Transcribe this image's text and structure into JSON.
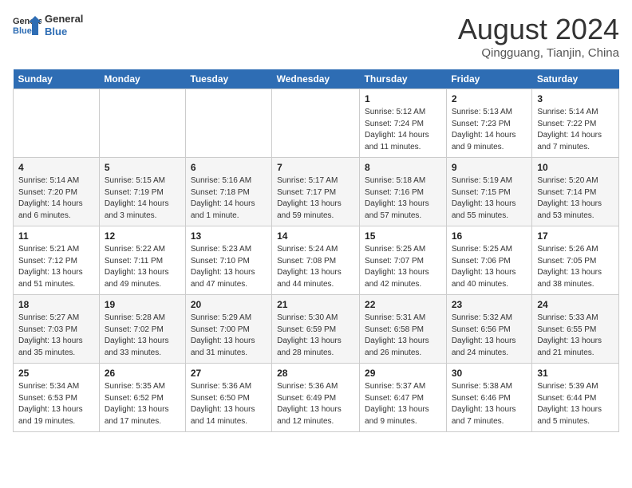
{
  "header": {
    "logo_line1": "General",
    "logo_line2": "Blue",
    "month_year": "August 2024",
    "location": "Qingguang, Tianjin, China"
  },
  "days_of_week": [
    "Sunday",
    "Monday",
    "Tuesday",
    "Wednesday",
    "Thursday",
    "Friday",
    "Saturday"
  ],
  "weeks": [
    [
      {
        "day": "",
        "info": ""
      },
      {
        "day": "",
        "info": ""
      },
      {
        "day": "",
        "info": ""
      },
      {
        "day": "",
        "info": ""
      },
      {
        "day": "1",
        "info": "Sunrise: 5:12 AM\nSunset: 7:24 PM\nDaylight: 14 hours\nand 11 minutes."
      },
      {
        "day": "2",
        "info": "Sunrise: 5:13 AM\nSunset: 7:23 PM\nDaylight: 14 hours\nand 9 minutes."
      },
      {
        "day": "3",
        "info": "Sunrise: 5:14 AM\nSunset: 7:22 PM\nDaylight: 14 hours\nand 7 minutes."
      }
    ],
    [
      {
        "day": "4",
        "info": "Sunrise: 5:14 AM\nSunset: 7:20 PM\nDaylight: 14 hours\nand 6 minutes."
      },
      {
        "day": "5",
        "info": "Sunrise: 5:15 AM\nSunset: 7:19 PM\nDaylight: 14 hours\nand 3 minutes."
      },
      {
        "day": "6",
        "info": "Sunrise: 5:16 AM\nSunset: 7:18 PM\nDaylight: 14 hours\nand 1 minute."
      },
      {
        "day": "7",
        "info": "Sunrise: 5:17 AM\nSunset: 7:17 PM\nDaylight: 13 hours\nand 59 minutes."
      },
      {
        "day": "8",
        "info": "Sunrise: 5:18 AM\nSunset: 7:16 PM\nDaylight: 13 hours\nand 57 minutes."
      },
      {
        "day": "9",
        "info": "Sunrise: 5:19 AM\nSunset: 7:15 PM\nDaylight: 13 hours\nand 55 minutes."
      },
      {
        "day": "10",
        "info": "Sunrise: 5:20 AM\nSunset: 7:14 PM\nDaylight: 13 hours\nand 53 minutes."
      }
    ],
    [
      {
        "day": "11",
        "info": "Sunrise: 5:21 AM\nSunset: 7:12 PM\nDaylight: 13 hours\nand 51 minutes."
      },
      {
        "day": "12",
        "info": "Sunrise: 5:22 AM\nSunset: 7:11 PM\nDaylight: 13 hours\nand 49 minutes."
      },
      {
        "day": "13",
        "info": "Sunrise: 5:23 AM\nSunset: 7:10 PM\nDaylight: 13 hours\nand 47 minutes."
      },
      {
        "day": "14",
        "info": "Sunrise: 5:24 AM\nSunset: 7:08 PM\nDaylight: 13 hours\nand 44 minutes."
      },
      {
        "day": "15",
        "info": "Sunrise: 5:25 AM\nSunset: 7:07 PM\nDaylight: 13 hours\nand 42 minutes."
      },
      {
        "day": "16",
        "info": "Sunrise: 5:25 AM\nSunset: 7:06 PM\nDaylight: 13 hours\nand 40 minutes."
      },
      {
        "day": "17",
        "info": "Sunrise: 5:26 AM\nSunset: 7:05 PM\nDaylight: 13 hours\nand 38 minutes."
      }
    ],
    [
      {
        "day": "18",
        "info": "Sunrise: 5:27 AM\nSunset: 7:03 PM\nDaylight: 13 hours\nand 35 minutes."
      },
      {
        "day": "19",
        "info": "Sunrise: 5:28 AM\nSunset: 7:02 PM\nDaylight: 13 hours\nand 33 minutes."
      },
      {
        "day": "20",
        "info": "Sunrise: 5:29 AM\nSunset: 7:00 PM\nDaylight: 13 hours\nand 31 minutes."
      },
      {
        "day": "21",
        "info": "Sunrise: 5:30 AM\nSunset: 6:59 PM\nDaylight: 13 hours\nand 28 minutes."
      },
      {
        "day": "22",
        "info": "Sunrise: 5:31 AM\nSunset: 6:58 PM\nDaylight: 13 hours\nand 26 minutes."
      },
      {
        "day": "23",
        "info": "Sunrise: 5:32 AM\nSunset: 6:56 PM\nDaylight: 13 hours\nand 24 minutes."
      },
      {
        "day": "24",
        "info": "Sunrise: 5:33 AM\nSunset: 6:55 PM\nDaylight: 13 hours\nand 21 minutes."
      }
    ],
    [
      {
        "day": "25",
        "info": "Sunrise: 5:34 AM\nSunset: 6:53 PM\nDaylight: 13 hours\nand 19 minutes."
      },
      {
        "day": "26",
        "info": "Sunrise: 5:35 AM\nSunset: 6:52 PM\nDaylight: 13 hours\nand 17 minutes."
      },
      {
        "day": "27",
        "info": "Sunrise: 5:36 AM\nSunset: 6:50 PM\nDaylight: 13 hours\nand 14 minutes."
      },
      {
        "day": "28",
        "info": "Sunrise: 5:36 AM\nSunset: 6:49 PM\nDaylight: 13 hours\nand 12 minutes."
      },
      {
        "day": "29",
        "info": "Sunrise: 5:37 AM\nSunset: 6:47 PM\nDaylight: 13 hours\nand 9 minutes."
      },
      {
        "day": "30",
        "info": "Sunrise: 5:38 AM\nSunset: 6:46 PM\nDaylight: 13 hours\nand 7 minutes."
      },
      {
        "day": "31",
        "info": "Sunrise: 5:39 AM\nSunset: 6:44 PM\nDaylight: 13 hours\nand 5 minutes."
      }
    ]
  ]
}
